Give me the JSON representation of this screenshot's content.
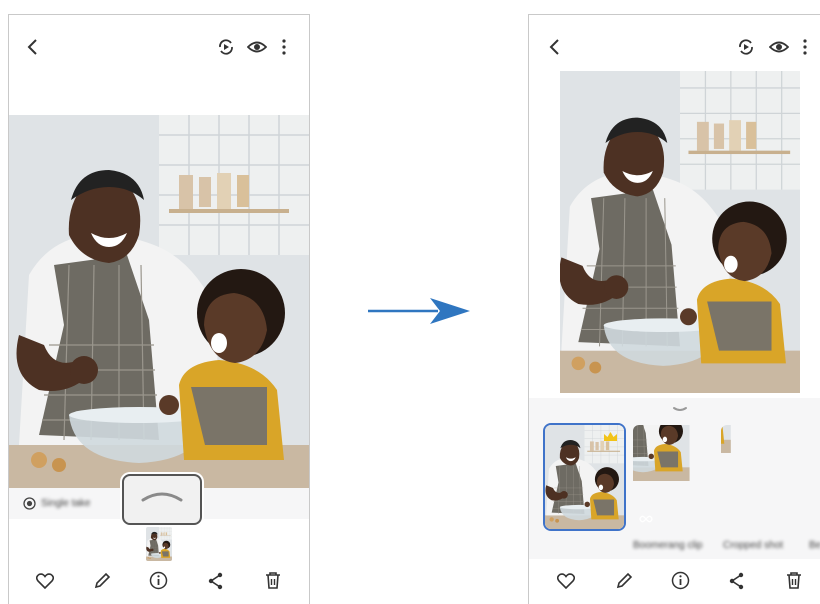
{
  "screen_a": {
    "suggestion_label": "Single take",
    "buttons": {
      "back": "back-arrow-icon",
      "motion": "motion-photo-icon",
      "view": "eye-icon",
      "more": "more-vertical-icon",
      "expand": "chevron-up-icon",
      "favorite": "heart-icon",
      "edit": "pencil-icon",
      "details": "info-icon",
      "share": "share-icon",
      "delete": "trash-icon"
    }
  },
  "screen_b": {
    "thumbnails": [
      {
        "label": "",
        "badge": "crown-icon",
        "selected": true
      },
      {
        "label": "Boomerang clip",
        "badge": "infinity-icon",
        "selected": false
      },
      {
        "label": "Cropped shot",
        "badge": "",
        "selected": false
      },
      {
        "label": "Be",
        "badge": "",
        "selected": false
      }
    ]
  },
  "colors": {
    "arrow": "#2f76c0",
    "highlight_border": "#3f73c9",
    "crown": "#f2c318",
    "shirt_yellow": "#d9a528",
    "apron": "#6e6b63"
  }
}
